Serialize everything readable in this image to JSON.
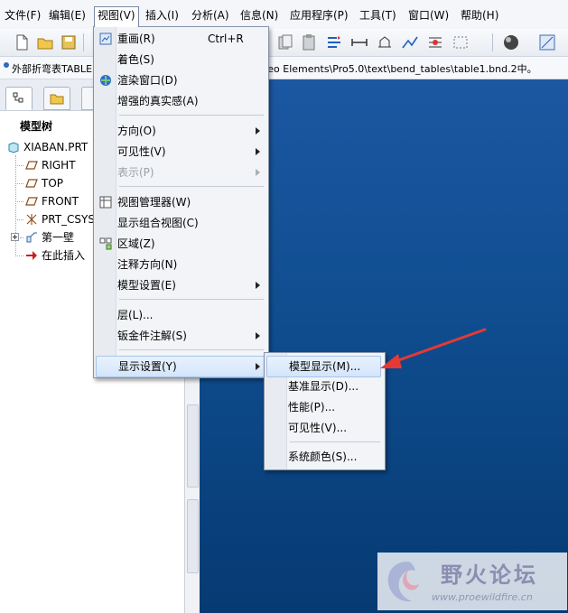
{
  "menubar": {
    "items": [
      "文件(F)",
      "编辑(E)",
      "视图(V)",
      "插入(I)",
      "分析(A)",
      "信息(N)",
      "应用程序(P)",
      "工具(T)",
      "窗口(W)",
      "帮助(H)"
    ]
  },
  "message_bar": {
    "left_text": "外部折弯表TABLE",
    "right_text": "reo Elements\\Pro5.0\\text\\bend_tables\\table1.bnd.2中。"
  },
  "model_tree": {
    "title": "模型树",
    "items": [
      {
        "label": "XIABAN.PRT",
        "icon": "part-icon"
      },
      {
        "label": "RIGHT",
        "icon": "datum-plane-icon"
      },
      {
        "label": "TOP",
        "icon": "datum-plane-icon"
      },
      {
        "label": "FRONT",
        "icon": "datum-plane-icon"
      },
      {
        "label": "PRT_CSYS",
        "icon": "csys-icon"
      },
      {
        "label": "第一壁",
        "icon": "wall-feature-icon"
      },
      {
        "label": "在此插入",
        "icon": "insert-here-arrow-icon"
      }
    ]
  },
  "view_menu": {
    "items": [
      {
        "label": "重画(R)",
        "shortcut": "Ctrl+R",
        "icon": "repaint-icon"
      },
      {
        "label": "着色(S)"
      },
      {
        "label": "渲染窗口(D)",
        "icon": "render-icon"
      },
      {
        "label": "增强的真实感(A)"
      },
      {
        "label": "方向(O)",
        "submenu": true
      },
      {
        "label": "可见性(V)",
        "submenu": true
      },
      {
        "label": "表示(P)",
        "submenu": true,
        "disabled": true
      },
      {
        "label": "视图管理器(W)",
        "icon": "view-manager-icon"
      },
      {
        "label": "显示组合视图(C)"
      },
      {
        "label": "区域(Z)",
        "icon": "zone-icon"
      },
      {
        "label": "注释方向(N)"
      },
      {
        "label": "模型设置(E)",
        "submenu": true
      },
      {
        "label": "层(L)..."
      },
      {
        "label": "钣金件注解(S)",
        "submenu": true
      },
      {
        "label": "显示设置(Y)",
        "submenu": true,
        "highlighted": true
      }
    ]
  },
  "display_settings_submenu": {
    "items": [
      {
        "label": "模型显示(M)...",
        "highlighted": true
      },
      {
        "label": "基准显示(D)..."
      },
      {
        "label": "性能(P)..."
      },
      {
        "label": "可见性(V)..."
      },
      {
        "label": "系统颜色(S)..."
      }
    ]
  },
  "watermark": {
    "title": "野火论坛",
    "url": "www.proewildfire.cn"
  },
  "colors": {
    "viewport_top": "#1c57a2",
    "viewport_bottom": "#063a72",
    "annotation_arrow": "#e53935"
  }
}
